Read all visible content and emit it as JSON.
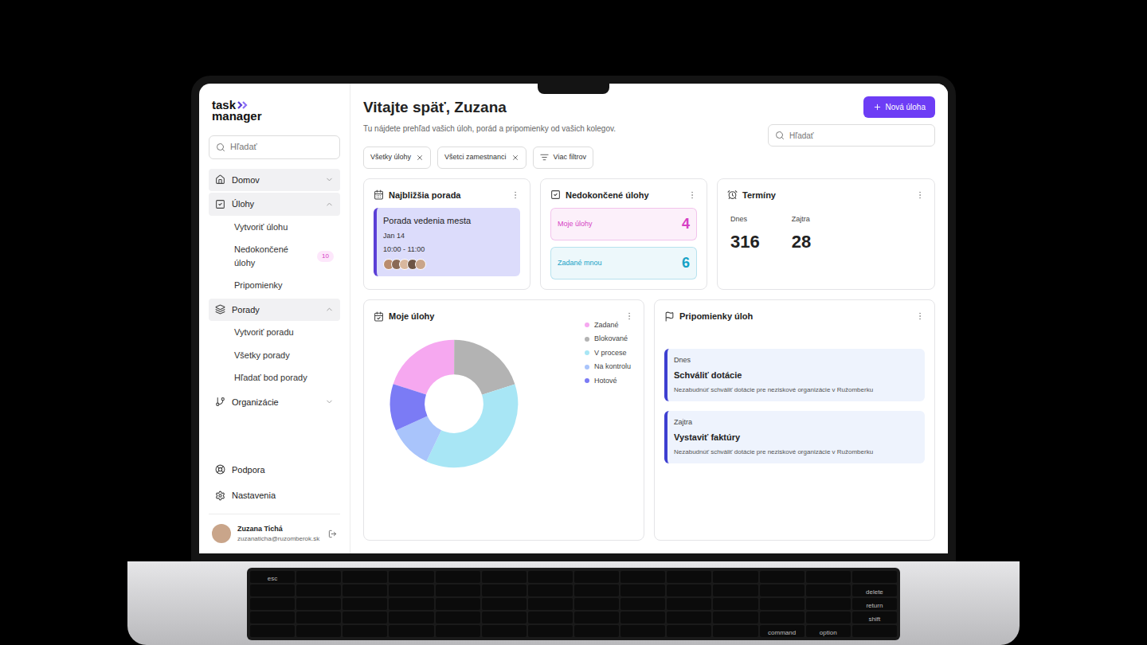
{
  "logo": {
    "line1": "task",
    "line2": "manager"
  },
  "sidebar": {
    "search": {
      "placeholder": "Hľadať"
    },
    "items": [
      {
        "label": "Domov",
        "highlighted": true,
        "expanded": false,
        "children": []
      },
      {
        "label": "Úlohy",
        "highlighted": true,
        "expanded": true,
        "children": [
          {
            "label": "Vytvoriť úlohu",
            "badge": ""
          },
          {
            "label": "Nedokončené úlohy",
            "badge": "10"
          },
          {
            "label": "Pripomienky",
            "badge": ""
          }
        ]
      },
      {
        "label": "Porady",
        "highlighted": true,
        "expanded": true,
        "children": [
          {
            "label": "Vytvoriť poradu",
            "badge": ""
          },
          {
            "label": "Všetky porady",
            "badge": ""
          },
          {
            "label": "Hľadať bod porady",
            "badge": ""
          }
        ]
      },
      {
        "label": "Organizácie",
        "highlighted": false,
        "expanded": false,
        "children": []
      }
    ],
    "footer": [
      {
        "label": "Podpora"
      },
      {
        "label": "Nastavenia"
      }
    ],
    "user": {
      "name": "Zuzana Tichá",
      "email": "zuzanaticha@ruzomberok.sk"
    }
  },
  "header": {
    "title": "Vitajte späť, Zuzana",
    "subtitle": "Tu nájdete prehľad vašich úloh, porád a pripomienky od vašich kolegov.",
    "button": "Nová úloha",
    "search": {
      "placeholder": "Hľadať"
    }
  },
  "filters": [
    {
      "label": "Všetky úlohy",
      "removable": true
    },
    {
      "label": "Všetci zamestnanci",
      "removable": true
    },
    {
      "label": "Viac filtrov",
      "removable": false
    }
  ],
  "next_meeting": {
    "title": "Najbližšia porada",
    "meeting": {
      "name": "Porada vedenia mesta",
      "date": "Jan 14",
      "time": "10:00 - 11:00",
      "attendee_count": 5
    }
  },
  "unfinished": {
    "title": "Nedokončené úlohy",
    "rows": [
      {
        "label": "Moje úlohy",
        "count": "4",
        "color": "#d63fc4"
      },
      {
        "label": "Zadané mnou",
        "count": "6",
        "color": "#17a2c6"
      }
    ]
  },
  "deadlines": {
    "title": "Termíny",
    "items": [
      {
        "label": "Dnes",
        "value": "316"
      },
      {
        "label": "Zajtra",
        "value": "28"
      }
    ]
  },
  "my_tasks_chart": {
    "title": "Moje úlohy",
    "series": [
      {
        "label": "Zadané",
        "value": 20,
        "color": "#f6a8f0"
      },
      {
        "label": "Blokované",
        "value": 20,
        "color": "#b3b3b3"
      },
      {
        "label": "V procese",
        "value": 37,
        "color": "#a8e6f5"
      },
      {
        "label": "Na kontrolu",
        "value": 11,
        "color": "#a9c4fb"
      },
      {
        "label": "Hotové",
        "value": 12,
        "color": "#7b7bf5"
      }
    ]
  },
  "reminders": {
    "title": "Pripomienky úloh",
    "items": [
      {
        "when": "Dnes",
        "title": "Schváliť dotácie",
        "text": "Nezabudnúť schváliť dotácie pre neziskové organizácie v Ružomberku"
      },
      {
        "when": "Zajtra",
        "title": "Vystaviť faktúry",
        "text": "Nezabudnúť schváliť dotácie pre neziskové organizácie v Ružomberku"
      }
    ]
  },
  "keyboard_keys": [
    "esc",
    "delete",
    "return",
    "shift",
    "option",
    "command"
  ]
}
